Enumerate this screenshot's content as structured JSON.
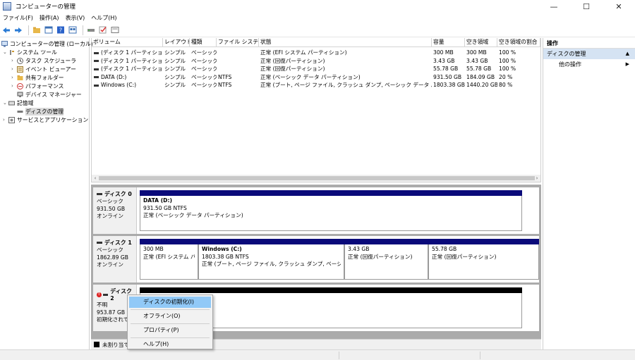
{
  "window": {
    "title": "コンピューターの管理",
    "controls": [
      "—",
      "☐",
      "✕"
    ]
  },
  "menu": [
    "ファイル(F)",
    "操作(A)",
    "表示(V)",
    "ヘルプ(H)"
  ],
  "toolbar_icons": [
    "back-arrow-icon",
    "forward-arrow-icon",
    "folder-up-icon",
    "properties-icon",
    "help-icon",
    "view-icon",
    "disk-icon",
    "check-icon",
    "console-icon"
  ],
  "tree": [
    {
      "label": "コンピューターの管理 (ローカル)",
      "icon": "computer-icon",
      "level": 0,
      "expander": ""
    },
    {
      "label": "システム ツール",
      "icon": "tools-icon",
      "level": 1,
      "expander": "⌄"
    },
    {
      "label": "タスク スケジューラ",
      "icon": "clock-icon",
      "level": 2,
      "expander": "›"
    },
    {
      "label": "イベント ビューアー",
      "icon": "event-viewer-icon",
      "level": 2,
      "expander": "›"
    },
    {
      "label": "共有フォルダー",
      "icon": "shared-folder-icon",
      "level": 2,
      "expander": "›"
    },
    {
      "label": "パフォーマンス",
      "icon": "performance-icon",
      "level": 2,
      "expander": "›"
    },
    {
      "label": "デバイス マネージャー",
      "icon": "device-manager-icon",
      "level": 2,
      "expander": ""
    },
    {
      "label": "記憶域",
      "icon": "storage-icon",
      "level": 1,
      "expander": "⌄"
    },
    {
      "label": "ディスクの管理",
      "icon": "disk-management-icon",
      "level": 2,
      "expander": "",
      "selected": true
    },
    {
      "label": "サービスとアプリケーション",
      "icon": "services-icon",
      "level": 1,
      "expander": "›"
    }
  ],
  "volume_table": {
    "headers": [
      "ボリューム",
      "レイアウト",
      "種類",
      "ファイル システム",
      "状態",
      "容量",
      "空き領域",
      "空き領域の割合"
    ],
    "rows": [
      [
        "(ディスク 1 パーティション 1)",
        "シンプル",
        "ベーシック",
        "",
        "正常 (EFI システム パーティション)",
        "300 MB",
        "300 MB",
        "100 %"
      ],
      [
        "(ディスク 1 パーティション 4)",
        "シンプル",
        "ベーシック",
        "",
        "正常 (回復パーティション)",
        "3.43 GB",
        "3.43 GB",
        "100 %"
      ],
      [
        "(ディスク 1 パーティション 5)",
        "シンプル",
        "ベーシック",
        "",
        "正常 (回復パーティション)",
        "55.78 GB",
        "55.78 GB",
        "100 %"
      ],
      [
        "DATA (D:)",
        "シンプル",
        "ベーシック",
        "NTFS",
        "正常 (ベーシック データ パーティション)",
        "931.50 GB",
        "184.09 GB",
        "20 %"
      ],
      [
        "Windows (C:)",
        "シンプル",
        "ベーシック",
        "NTFS",
        "正常 (ブート, ページ ファイル, クラッシュ ダンプ, ベーシック データ パーティション)",
        "1803.38 GB",
        "1440.20 GB",
        "80 %"
      ]
    ]
  },
  "disks": [
    {
      "name": "ディスク 0",
      "type": "ベーシック",
      "size": "931.50 GB",
      "status": "オンライン",
      "partitions": [
        {
          "title": "DATA  (D:)",
          "size": "931.50 GB NTFS",
          "status": "正常 (ベーシック データ パーティション)"
        }
      ]
    },
    {
      "name": "ディスク 1",
      "type": "ベーシック",
      "size": "1862.89 GB",
      "status": "オンライン",
      "partitions": [
        {
          "title": "",
          "size": "300 MB",
          "status": "正常 (EFI システム パー"
        },
        {
          "title": "Windows  (C:)",
          "size": "1803.38 GB NTFS",
          "status": "正常 (ブート, ページ ファイル, クラッシュ ダンプ, ベーシック データ /"
        },
        {
          "title": "",
          "size": "3.43 GB",
          "status": "正常 (回復パーティション)"
        },
        {
          "title": "",
          "size": "55.78 GB",
          "status": "正常 (回復パーティション)"
        }
      ]
    },
    {
      "name": "ディスク 2",
      "type": "不明",
      "size": "953.87 GB",
      "status": "初期化されて"
    }
  ],
  "legend": {
    "label": "未割り当て",
    "color": "#000000"
  },
  "actions": {
    "header": "操作",
    "section": "ディスクの管理",
    "items": [
      "他の操作"
    ]
  },
  "context_menu": {
    "items": [
      "ディスクの初期化(I)",
      "オフライン(O)",
      "プロパティ(P)",
      "ヘルプ(H)"
    ],
    "highlighted_index": 0
  },
  "colors": {
    "partition_bar": "#0a0a7a",
    "unallocated_bar": "#000000",
    "menu_highlight": "#91c9f7",
    "action_section": "#d5e3f3"
  }
}
